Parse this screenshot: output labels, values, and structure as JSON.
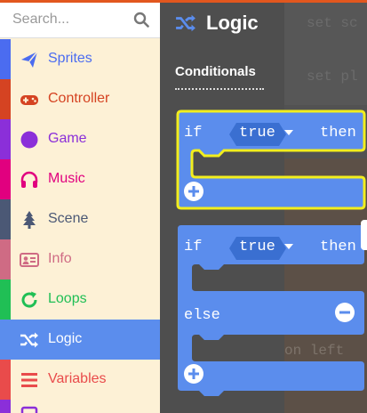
{
  "search": {
    "placeholder": "Search..."
  },
  "categories": [
    {
      "label": "Sprites",
      "color": "#4b6cf0",
      "icon": "paper-plane-icon"
    },
    {
      "label": "Controller",
      "color": "#d54322",
      "icon": "gamepad-icon"
    },
    {
      "label": "Game",
      "color": "#8b2fd9",
      "icon": "circle-icon"
    },
    {
      "label": "Music",
      "color": "#e1007f",
      "icon": "headphones-icon"
    },
    {
      "label": "Scene",
      "color": "#4b5875",
      "icon": "tree-icon"
    },
    {
      "label": "Info",
      "color": "#cf6b84",
      "icon": "id-card-icon"
    },
    {
      "label": "Loops",
      "color": "#20bf55",
      "icon": "loop-arrow-icon"
    },
    {
      "label": "Logic",
      "color": "#5b8ded",
      "icon": "shuffle-icon",
      "selected": true
    },
    {
      "label": "Variables",
      "color": "#e94b4b",
      "icon": "list-icon"
    }
  ],
  "flyout": {
    "title": "Logic",
    "section": "Conditionals",
    "block1": {
      "if": "if",
      "value": "true",
      "then": "then"
    },
    "block2": {
      "if": "if",
      "value": "true",
      "then": "then",
      "else": "else"
    }
  },
  "background_code": {
    "line1": "set sc",
    "line2": "set pl",
    "line3": "on left"
  },
  "colors": {
    "logic_block": "#5b8ded",
    "logic_dark": "#3a6fd1",
    "highlight": "#f2ee1d"
  }
}
